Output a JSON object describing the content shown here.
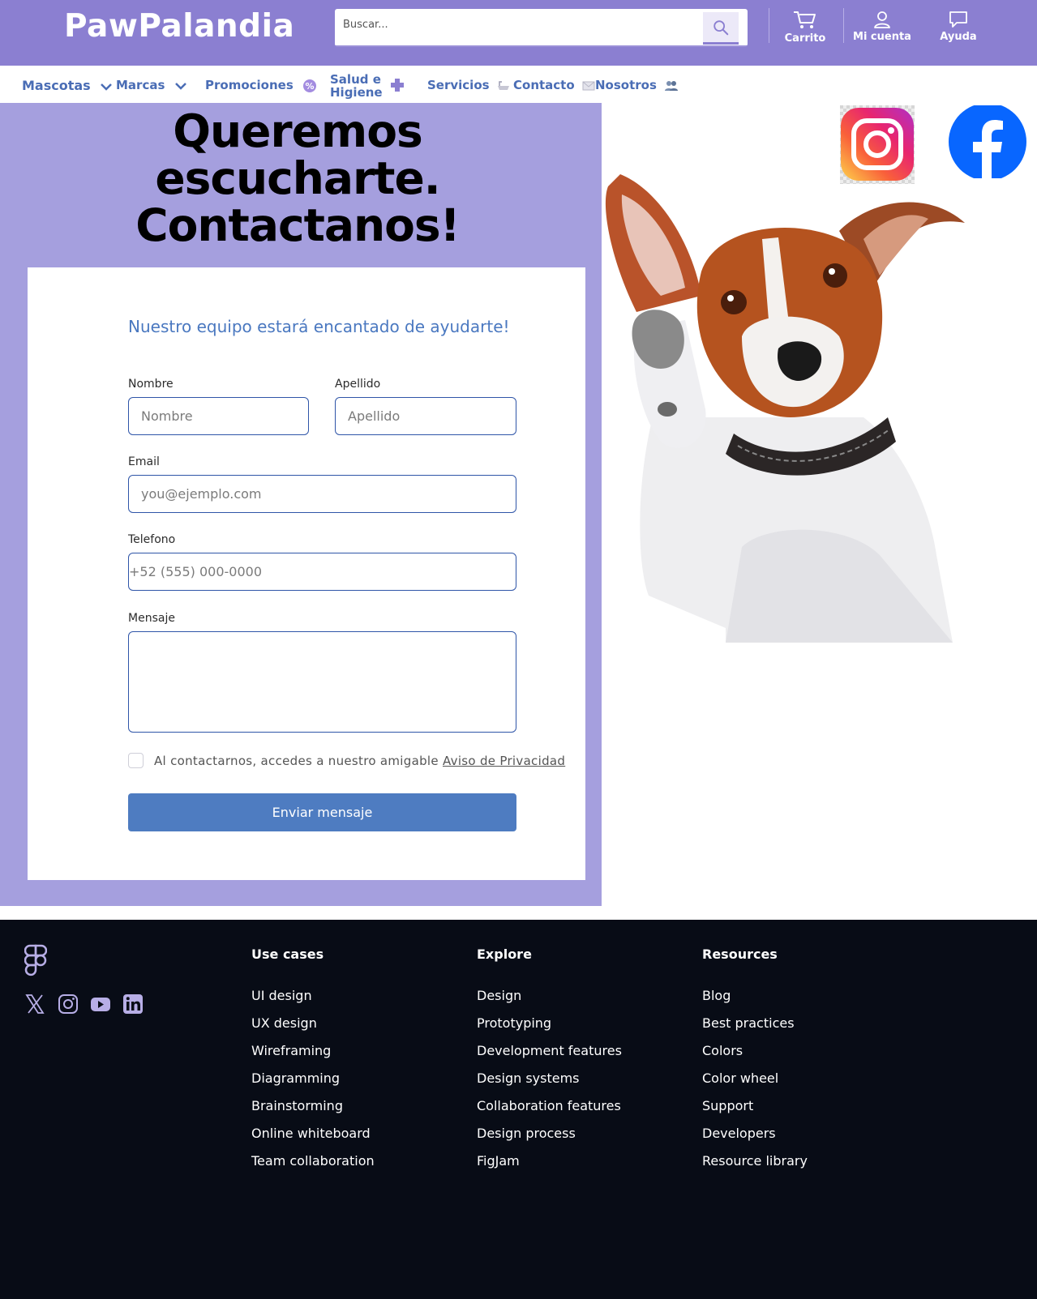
{
  "header": {
    "brand": "PawPalandia",
    "search_placeholder": "Buscar...",
    "cart_label": "Carrito",
    "account_label": "Mi cuenta",
    "help_label": "Ayuda",
    "accent": "#8b7fd1"
  },
  "nav": {
    "items": [
      "Mascotas",
      "Marcas",
      "Promociones",
      "Salud e",
      "Higiene",
      "Servicios",
      "Contacto",
      "Nosotros"
    ]
  },
  "contact": {
    "headline_1": "Queremos",
    "headline_2": "escucharte.",
    "headline_3": "Contactanos!",
    "subtitle": "Nuestro equipo estará encantado de ayudarte!",
    "first_name_label": "Nombre",
    "first_name_placeholder": "Nombre",
    "last_name_label": "Apellido",
    "last_name_placeholder": "Apellido",
    "email_label": "Email",
    "email_placeholder": "you@ejemplo.com",
    "phone_label": "Telefono",
    "phone_placeholder": "+52 (555) 000-0000",
    "message_label": "Mensaje",
    "consent_text": "Al contactarnos, accedes a nuestro amigable ",
    "consent_link": "Aviso de Privacidad",
    "submit_label": "Enviar mensaje"
  },
  "footer": {
    "columns": [
      {
        "heading": "Use cases",
        "links": [
          "UI design",
          "UX design",
          "Wireframing",
          "Diagramming",
          "Brainstorming",
          "Online whiteboard",
          "Team collaboration"
        ]
      },
      {
        "heading": "Explore",
        "links": [
          "Design",
          "Prototyping",
          "Development features",
          "Design systems",
          "Collaboration features",
          "Design process",
          "FigJam"
        ]
      },
      {
        "heading": "Resources",
        "links": [
          "Blog",
          "Best practices",
          "Colors",
          "Color wheel",
          "Support",
          "Developers",
          "Resource library"
        ]
      }
    ],
    "social_icons": [
      "x-icon",
      "instagram-icon",
      "youtube-icon",
      "linkedin-icon"
    ]
  }
}
